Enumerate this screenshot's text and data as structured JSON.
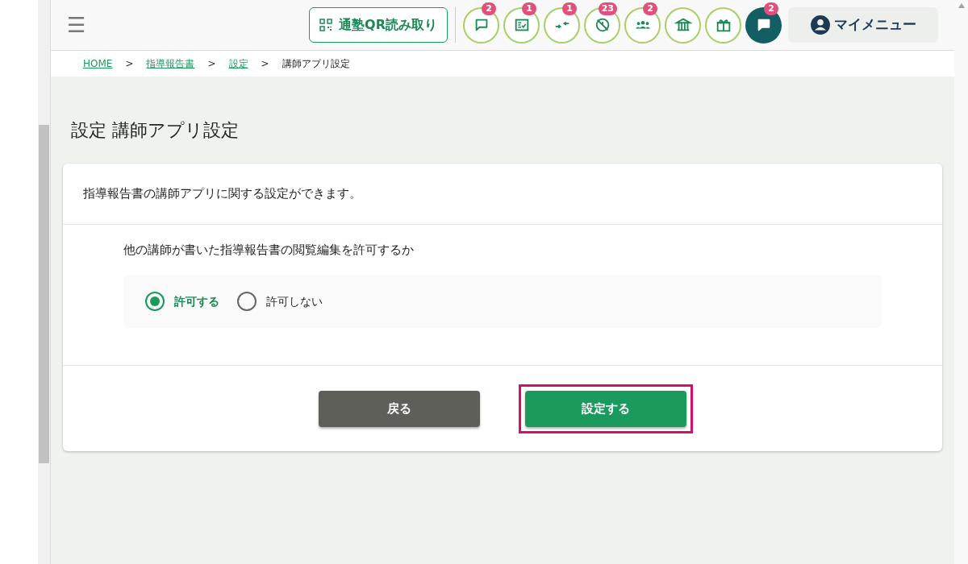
{
  "header": {
    "menu_icon": "☰",
    "qr_button": "通塾QR読み取り",
    "icon_buttons": [
      {
        "kind": "chat",
        "badge": "2",
        "filled": false
      },
      {
        "kind": "checklist",
        "badge": "1",
        "filled": false
      },
      {
        "kind": "merge",
        "badge": "1",
        "filled": false
      },
      {
        "kind": "blocked",
        "badge": "23",
        "filled": false
      },
      {
        "kind": "people",
        "badge": "2",
        "filled": false
      },
      {
        "kind": "museum",
        "filled": false
      },
      {
        "kind": "gift",
        "filled": false
      },
      {
        "kind": "chat",
        "badge": "2",
        "filled": true
      }
    ],
    "my_menu": "マイメニュー"
  },
  "breadcrumb": [
    {
      "label": "HOME",
      "link": true
    },
    {
      "label": "指導報告書",
      "link": true
    },
    {
      "label": "設定",
      "link": true
    },
    {
      "label": "講師アプリ設定",
      "link": false
    }
  ],
  "breadcrumb_separator": ">",
  "page_title": "設定 講師アプリ設定",
  "card": {
    "description": "指導報告書の講師アプリに関する設定ができます。",
    "question": "他の講師が書いた指導報告書の閲覧編集を許可するか",
    "options": [
      {
        "label": "許可する",
        "selected": true
      },
      {
        "label": "許可しない",
        "selected": false
      }
    ],
    "buttons": [
      {
        "label": "戻る",
        "kind": "back",
        "highlighted": false
      },
      {
        "label": "設定する",
        "kind": "primary",
        "highlighted": true
      }
    ]
  }
}
